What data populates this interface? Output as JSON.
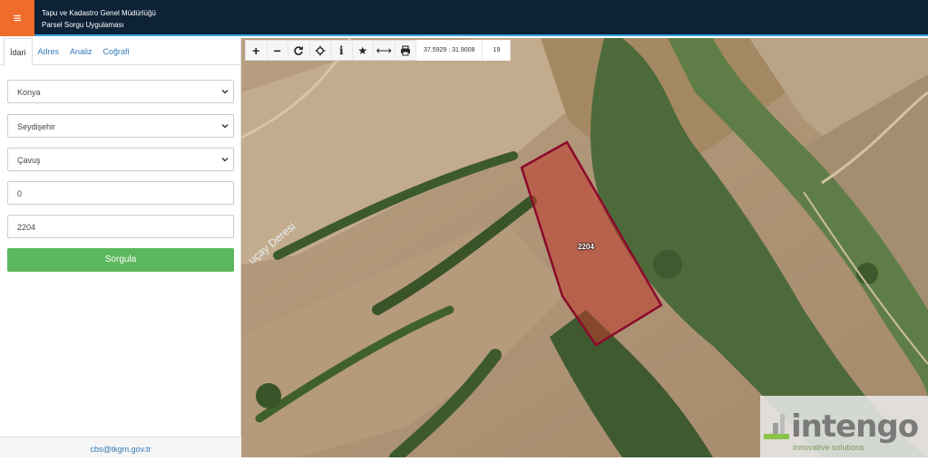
{
  "header": {
    "menu_icon": "hamburger-icon",
    "title_line1": "Tapu ve Kadastro Genel Müdürlüğü",
    "title_line2": "Parsel Sorgu Uygulaması",
    "bar_color": "#0d2137",
    "accent": "#ef6c2a"
  },
  "sidebar": {
    "tabs": [
      {
        "label": "İdari"
      },
      {
        "label": "Adres"
      },
      {
        "label": "Analiz"
      },
      {
        "label": "Coğrafi"
      }
    ],
    "province": "Konya",
    "district": "Seydişehir",
    "neighborhood": "Çavuş",
    "block": "0",
    "parcel": "2204",
    "query_button": "Sorgula",
    "footer_email": "cbs@tkgm.gov.tr"
  },
  "map": {
    "toolbar": [
      {
        "icon": "plus-icon",
        "glyph": "+"
      },
      {
        "icon": "minus-icon",
        "glyph": "−"
      },
      {
        "icon": "refresh-icon",
        "glyph": ""
      },
      {
        "icon": "locate-icon",
        "glyph": ""
      },
      {
        "icon": "info-icon",
        "glyph": "i"
      },
      {
        "icon": "star-icon",
        "glyph": "★"
      },
      {
        "icon": "measure-icon",
        "glyph": "⟷"
      },
      {
        "icon": "print-icon",
        "glyph": ""
      }
    ],
    "coordinates": "37.5929 : 31.9008",
    "zoom": "19",
    "parcel_label": "2204",
    "stream_label": "uçay Deresi",
    "parcel_fill": "#c0392b",
    "parcel_stroke": "#8b0a2a",
    "watermark": "intengo",
    "watermark_sub": "innovative solutions"
  }
}
